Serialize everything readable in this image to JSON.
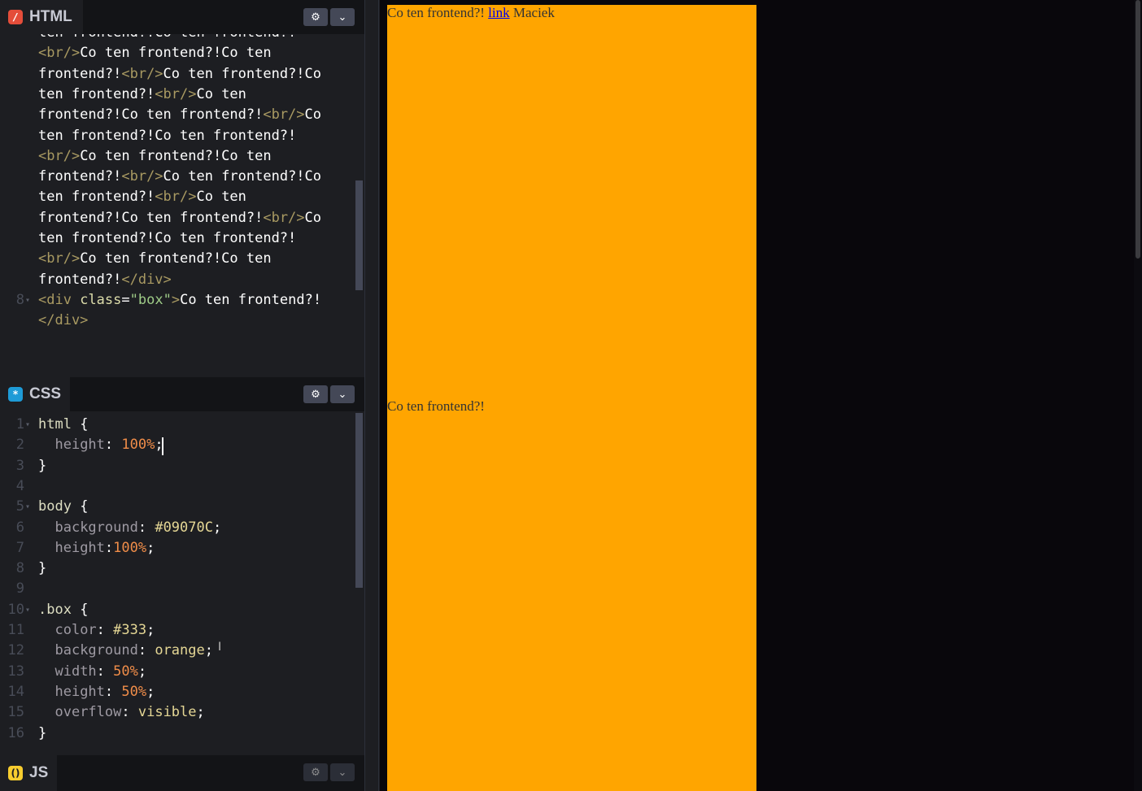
{
  "html_panel": {
    "title": "HTML",
    "lines": [
      {
        "num": "",
        "html": "ten frontend?!Co ten frontend?!"
      },
      {
        "num": "",
        "html": "<span class='tag'>&lt;br/&gt;</span>Co ten frontend?!Co ten"
      },
      {
        "num": "",
        "html": "frontend?!<span class='tag'>&lt;br/&gt;</span>Co ten frontend?!Co"
      },
      {
        "num": "",
        "html": "ten frontend?!<span class='tag'>&lt;br/&gt;</span>Co ten"
      },
      {
        "num": "",
        "html": "frontend?!Co ten frontend?!<span class='tag'>&lt;br/&gt;</span>Co"
      },
      {
        "num": "",
        "html": "ten frontend?!Co ten frontend?!"
      },
      {
        "num": "",
        "html": "<span class='tag'>&lt;br/&gt;</span>Co ten frontend?!Co ten"
      },
      {
        "num": "",
        "html": "frontend?!<span class='tag'>&lt;br/&gt;</span>Co ten frontend?!Co"
      },
      {
        "num": "",
        "html": "ten frontend?!<span class='tag'>&lt;br/&gt;</span>Co ten"
      },
      {
        "num": "",
        "html": "frontend?!Co ten frontend?!<span class='tag'>&lt;br/&gt;</span>Co"
      },
      {
        "num": "",
        "html": "ten frontend?!Co ten frontend?!"
      },
      {
        "num": "",
        "html": "<span class='tag'>&lt;br/&gt;</span>Co ten frontend?!Co ten"
      },
      {
        "num": "",
        "html": "frontend?!<span class='tag'>&lt;/div&gt;</span>"
      },
      {
        "num": "8",
        "html": "<span class='tag'>&lt;div</span> <span class='attr'>class</span>=<span class='str'>\"box\"</span><span class='tag'>&gt;</span>Co ten frontend?!"
      },
      {
        "num": "",
        "html": "<span class='tag'>&lt;/div&gt;</span>"
      }
    ]
  },
  "css_panel": {
    "title": "CSS",
    "lines": [
      {
        "num": "1",
        "html": "<span class='sel'>html</span> {"
      },
      {
        "num": "2",
        "html": "  <span class='prop'>height</span>: <span class='num'>100%</span>;"
      },
      {
        "num": "3",
        "html": "}"
      },
      {
        "num": "4",
        "html": ""
      },
      {
        "num": "5",
        "html": "<span class='sel'>body</span> {"
      },
      {
        "num": "6",
        "html": "  <span class='prop'>background</span>: <span class='val'>#09070C</span>;"
      },
      {
        "num": "7",
        "html": "  <span class='prop'>height</span>:<span class='num'>100%</span>;"
      },
      {
        "num": "8",
        "html": "}"
      },
      {
        "num": "9",
        "html": ""
      },
      {
        "num": "10",
        "html": "<span class='sel'>.box</span> {"
      },
      {
        "num": "11",
        "html": "  <span class='prop'>color</span>: <span class='val'>#333</span>;"
      },
      {
        "num": "12",
        "html": "  <span class='prop'>background</span>: <span class='val'>orange</span>;"
      },
      {
        "num": "13",
        "html": "  <span class='prop'>width</span>: <span class='num'>50%</span>;"
      },
      {
        "num": "14",
        "html": "  <span class='prop'>height</span>: <span class='num'>50%</span>;"
      },
      {
        "num": "15",
        "html": "  <span class='prop'>overflow</span>: <span class='val'>visible</span>;"
      },
      {
        "num": "16",
        "html": "}"
      }
    ]
  },
  "js_panel": {
    "title": "JS"
  },
  "preview": {
    "box1_text": "Co ten frontend?!",
    "box1_link": "link",
    "box1_author": "Maciek",
    "box2_text": "Co ten frontend?!"
  },
  "colors": {
    "body_background": "#09070C",
    "box_background": "orange",
    "box_color": "#333"
  }
}
